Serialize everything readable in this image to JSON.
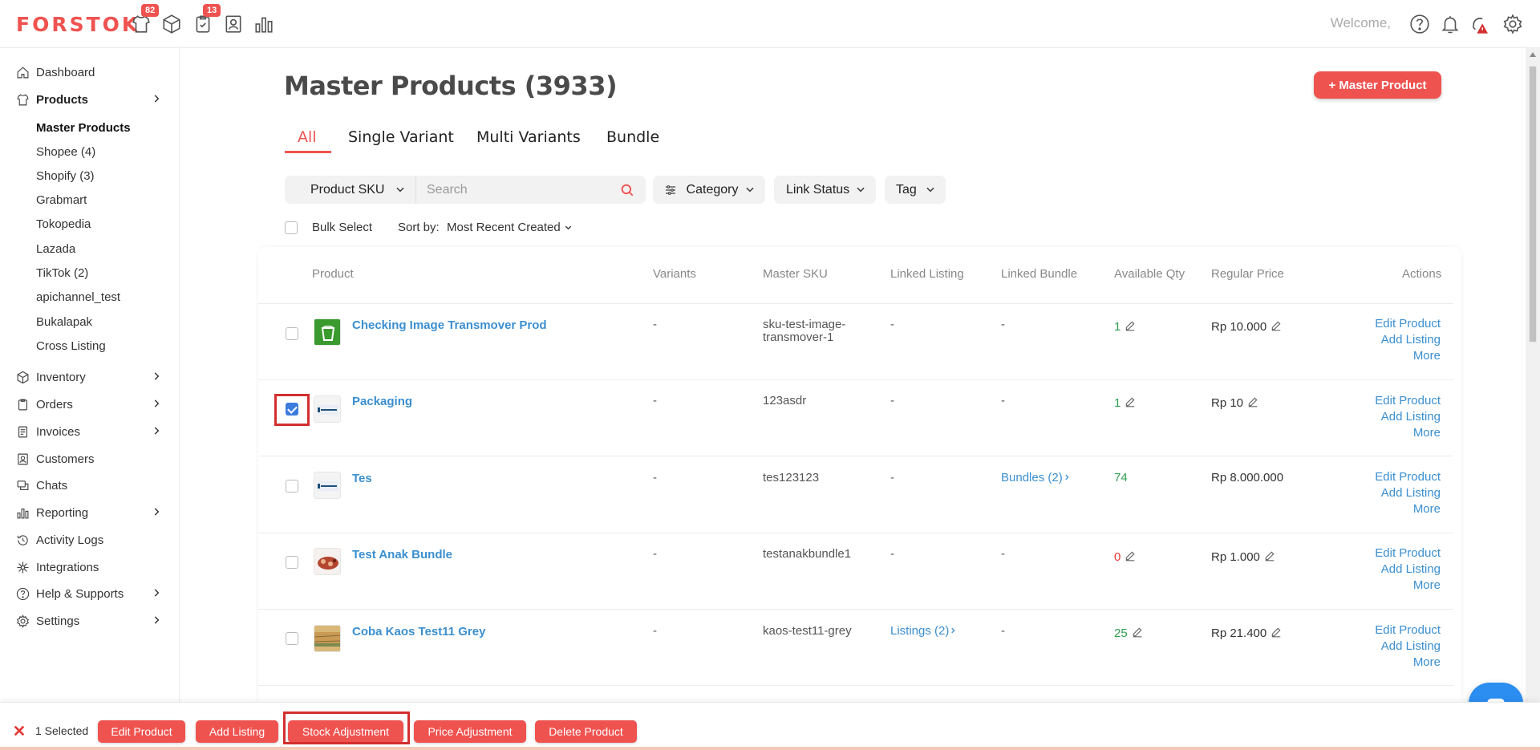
{
  "topbar": {
    "logo": "FORSTOK",
    "badges": {
      "products": "82",
      "orders": "13"
    },
    "welcome": "Welcome,"
  },
  "sidebar": {
    "items": [
      {
        "label": "Dashboard"
      },
      {
        "label": "Products"
      },
      {
        "label": "Inventory"
      },
      {
        "label": "Orders"
      },
      {
        "label": "Invoices"
      },
      {
        "label": "Customers"
      },
      {
        "label": "Chats"
      },
      {
        "label": "Reporting"
      },
      {
        "label": "Activity Logs"
      },
      {
        "label": "Integrations"
      },
      {
        "label": "Help & Supports"
      },
      {
        "label": "Settings"
      }
    ],
    "sub_items": [
      {
        "label": "Master Products"
      },
      {
        "label": "Shopee (4)"
      },
      {
        "label": "Shopify (3)"
      },
      {
        "label": "Grabmart"
      },
      {
        "label": "Tokopedia"
      },
      {
        "label": "Lazada"
      },
      {
        "label": "TikTok (2)"
      },
      {
        "label": "apichannel_test"
      },
      {
        "label": "Bukalapak"
      },
      {
        "label": "Cross Listing"
      }
    ]
  },
  "main": {
    "title": "Master Products (3933)",
    "add_button": "+ Master Product",
    "tabs": [
      {
        "label": "All"
      },
      {
        "label": "Single Variant"
      },
      {
        "label": "Multi Variants"
      },
      {
        "label": "Bundle"
      }
    ],
    "filters": {
      "sku_select": "Product SKU",
      "search_placeholder": "Search",
      "category": "Category",
      "link_status": "Link Status",
      "tag": "Tag"
    },
    "bulk_select": "Bulk Select",
    "sort_label": "Sort by:",
    "sort_value": "Most Recent Created"
  },
  "table": {
    "headers": [
      "Product",
      "Variants",
      "Master SKU",
      "Linked Listing",
      "Linked Bundle",
      "Available Qty",
      "Regular Price",
      "Actions"
    ],
    "action_labels": {
      "edit": "Edit Product",
      "add": "Add Listing",
      "more": "More"
    },
    "rows": [
      {
        "name": "Checking Image Transmover Prod",
        "variants": "-",
        "sku_line1": "sku-test-image-",
        "sku_line2": "transmover-1",
        "listing": "-",
        "bundle": "-",
        "qty": "1",
        "price": "Rp 10.000",
        "checked": false
      },
      {
        "name": "Packaging",
        "variants": "-",
        "sku_line1": "123asdr",
        "sku_line2": "",
        "listing": "-",
        "bundle": "-",
        "qty": "1",
        "price": "Rp 10",
        "checked": true
      },
      {
        "name": "Tes",
        "variants": "-",
        "sku_line1": "tes123123",
        "sku_line2": "",
        "listing": "-",
        "bundle": "Bundles (2)",
        "qty": "74",
        "price": "Rp 8.000.000",
        "checked": false
      },
      {
        "name": "Test Anak Bundle",
        "variants": "-",
        "sku_line1": "testanakbundle1",
        "sku_line2": "",
        "listing": "-",
        "bundle": "-",
        "qty": "0",
        "price": "Rp 1.000",
        "checked": false
      },
      {
        "name": "Coba Kaos Test11 Grey",
        "variants": "-",
        "sku_line1": "kaos-test11-grey",
        "sku_line2": "",
        "listing": "Listings (2)",
        "bundle": "-",
        "qty": "25",
        "price": "Rp 21.400",
        "checked": false
      }
    ]
  },
  "bottombar": {
    "selected_text": "1 Selected",
    "buttons": [
      "Edit Product",
      "Add Listing",
      "Stock Adjustment",
      "Price Adjustment",
      "Delete Product"
    ]
  },
  "colors": {
    "accent": "#ef5350",
    "link": "#3b8fd0",
    "checkbox": "#3b7ddd",
    "highlight": "#d32f2f"
  }
}
